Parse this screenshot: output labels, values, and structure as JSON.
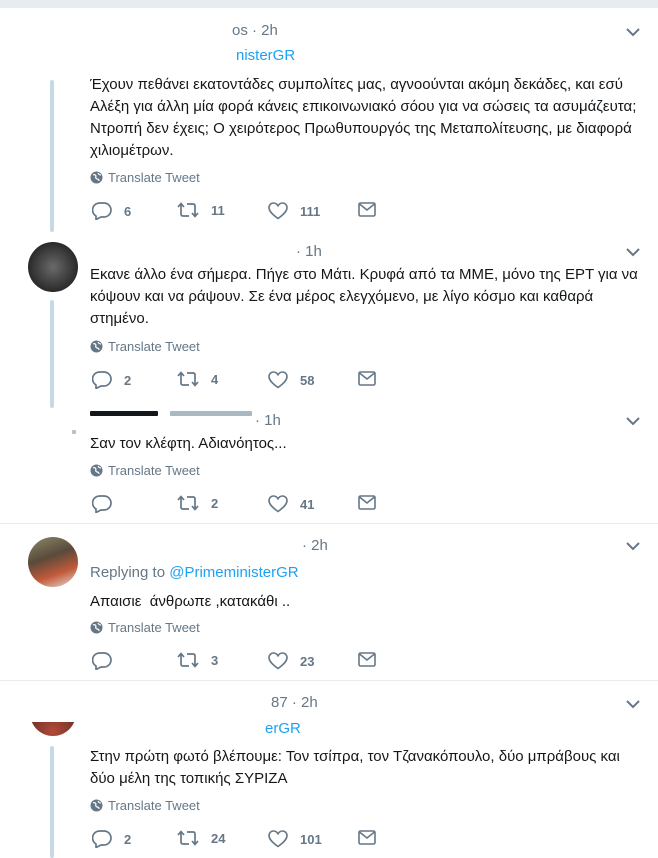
{
  "ui": {
    "translate_label": "Translate Tweet"
  },
  "tweets": [
    {
      "handle_fragment": "os",
      "time": "· 2h",
      "name_fragment": "nisterGR",
      "text": "Έχουν πεθάνει εκατοντάδες συμπολίτες μας, αγνοούνται ακόμη δεκάδες, και εσύ Αλέξη για άλλη μία φορά κάνεις επικοινωνιακό σόου για να σώσεις τα ασυμάζευτα; Ντροπή δεν έχεις; Ο χειρότερος Πρωθυπουργός της Μεταπολίτευσης, με διαφορά χιλιομέτρων.",
      "replies": "6",
      "retweets": "11",
      "likes": "111"
    },
    {
      "time": "· 1h",
      "text": "Εκανε άλλο ένα σήμερα. Πήγε στο Μάτι. Κρυφά από τα ΜΜΕ, μόνο της ΕΡΤ για να κόψουν και να ράψουν. Σε ένα μέρος ελεγχόμενο, με λίγο κόσμο και καθαρά στημένο.",
      "replies": "2",
      "retweets": "4",
      "likes": "58"
    },
    {
      "time": "· 1h",
      "text": "Σαν τον κλέφτη. Αδιανόητος...",
      "replies": "",
      "retweets": "2",
      "likes": "41"
    },
    {
      "time": "· 2h",
      "replying_prefix": "Replying to",
      "replying_handle": "@PrimeministerGR",
      "text": "Απαισιε  άνθρωπε ,κατακάθι ..",
      "replies": "",
      "retweets": "3",
      "likes": "23"
    },
    {
      "handle_fragment": "87",
      "time": "· 2h",
      "name_fragment": "erGR",
      "text": "Στην πρώτη φωτό βλέπουμε: Τον τσίπρα, τον Τζανακόπουλο, δύο μπράβους και δύο μέλη της τοπικής ΣΥΡΙΖΑ",
      "replies": "2",
      "retweets": "24",
      "likes": "101"
    }
  ]
}
